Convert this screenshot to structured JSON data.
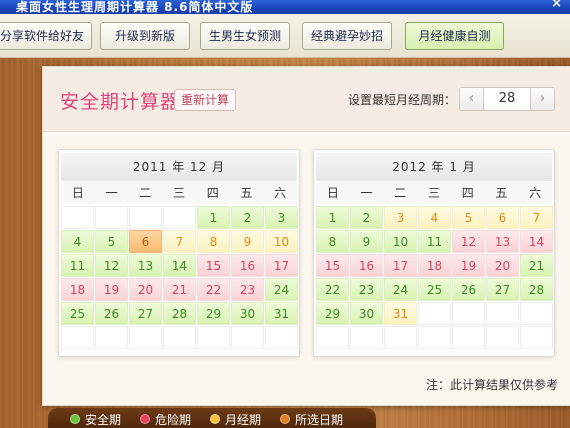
{
  "window": {
    "title": "桌面女性生理周期计算器 8.6简体中文版",
    "close_glyph": "×"
  },
  "toolbar": {
    "buttons": [
      {
        "label": "分享软件给好友",
        "active": false
      },
      {
        "label": "升级到新版",
        "active": false
      },
      {
        "label": "生男生女预测",
        "active": false
      },
      {
        "label": "经典避孕妙招",
        "active": false
      },
      {
        "label": "月经健康自测",
        "active": true
      }
    ]
  },
  "header": {
    "title": "安全期计算器",
    "recalc_label": "重新计算",
    "cycle_label": "设置最短月经周期：",
    "cycle_value": "28",
    "minus_glyph": "‹",
    "plus_glyph": "›"
  },
  "calendar": {
    "weekdays": [
      "日",
      "一",
      "二",
      "三",
      "四",
      "五",
      "六"
    ],
    "months": [
      {
        "title": "2011 年 12 月",
        "days": [
          {
            "d": "",
            "t": "empty"
          },
          {
            "d": "",
            "t": "empty"
          },
          {
            "d": "",
            "t": "empty"
          },
          {
            "d": "",
            "t": "empty"
          },
          {
            "d": "1",
            "t": "safe"
          },
          {
            "d": "2",
            "t": "safe"
          },
          {
            "d": "3",
            "t": "safe"
          },
          {
            "d": "4",
            "t": "safe"
          },
          {
            "d": "5",
            "t": "safe"
          },
          {
            "d": "6",
            "t": "selected"
          },
          {
            "d": "7",
            "t": "period"
          },
          {
            "d": "8",
            "t": "period"
          },
          {
            "d": "9",
            "t": "period"
          },
          {
            "d": "10",
            "t": "period"
          },
          {
            "d": "11",
            "t": "safe"
          },
          {
            "d": "12",
            "t": "safe"
          },
          {
            "d": "13",
            "t": "safe"
          },
          {
            "d": "14",
            "t": "safe"
          },
          {
            "d": "15",
            "t": "danger"
          },
          {
            "d": "16",
            "t": "danger"
          },
          {
            "d": "17",
            "t": "danger"
          },
          {
            "d": "18",
            "t": "danger"
          },
          {
            "d": "19",
            "t": "danger"
          },
          {
            "d": "20",
            "t": "danger"
          },
          {
            "d": "21",
            "t": "danger"
          },
          {
            "d": "22",
            "t": "danger"
          },
          {
            "d": "23",
            "t": "danger"
          },
          {
            "d": "24",
            "t": "safe"
          },
          {
            "d": "25",
            "t": "safe"
          },
          {
            "d": "26",
            "t": "safe"
          },
          {
            "d": "27",
            "t": "safe"
          },
          {
            "d": "28",
            "t": "safe"
          },
          {
            "d": "29",
            "t": "safe"
          },
          {
            "d": "30",
            "t": "safe"
          },
          {
            "d": "31",
            "t": "safe"
          },
          {
            "d": "",
            "t": "empty"
          },
          {
            "d": "",
            "t": "empty"
          },
          {
            "d": "",
            "t": "empty"
          },
          {
            "d": "",
            "t": "empty"
          },
          {
            "d": "",
            "t": "empty"
          },
          {
            "d": "",
            "t": "empty"
          },
          {
            "d": "",
            "t": "empty"
          }
        ]
      },
      {
        "title": "2012 年 1 月",
        "days": [
          {
            "d": "1",
            "t": "safe"
          },
          {
            "d": "2",
            "t": "safe"
          },
          {
            "d": "3",
            "t": "period"
          },
          {
            "d": "4",
            "t": "period"
          },
          {
            "d": "5",
            "t": "period"
          },
          {
            "d": "6",
            "t": "period"
          },
          {
            "d": "7",
            "t": "period"
          },
          {
            "d": "8",
            "t": "safe"
          },
          {
            "d": "9",
            "t": "safe"
          },
          {
            "d": "10",
            "t": "safe"
          },
          {
            "d": "11",
            "t": "safe"
          },
          {
            "d": "12",
            "t": "danger"
          },
          {
            "d": "13",
            "t": "danger"
          },
          {
            "d": "14",
            "t": "danger"
          },
          {
            "d": "15",
            "t": "danger"
          },
          {
            "d": "16",
            "t": "danger"
          },
          {
            "d": "17",
            "t": "danger"
          },
          {
            "d": "18",
            "t": "danger"
          },
          {
            "d": "19",
            "t": "danger"
          },
          {
            "d": "20",
            "t": "danger"
          },
          {
            "d": "21",
            "t": "safe"
          },
          {
            "d": "22",
            "t": "safe"
          },
          {
            "d": "23",
            "t": "safe"
          },
          {
            "d": "24",
            "t": "safe"
          },
          {
            "d": "25",
            "t": "safe"
          },
          {
            "d": "26",
            "t": "safe"
          },
          {
            "d": "27",
            "t": "safe"
          },
          {
            "d": "28",
            "t": "safe"
          },
          {
            "d": "29",
            "t": "safe"
          },
          {
            "d": "30",
            "t": "safe"
          },
          {
            "d": "31",
            "t": "period"
          },
          {
            "d": "",
            "t": "empty"
          },
          {
            "d": "",
            "t": "empty"
          },
          {
            "d": "",
            "t": "empty"
          },
          {
            "d": "",
            "t": "empty"
          },
          {
            "d": "",
            "t": "empty"
          },
          {
            "d": "",
            "t": "empty"
          },
          {
            "d": "",
            "t": "empty"
          },
          {
            "d": "",
            "t": "empty"
          },
          {
            "d": "",
            "t": "empty"
          },
          {
            "d": "",
            "t": "empty"
          },
          {
            "d": "",
            "t": "empty"
          }
        ]
      }
    ]
  },
  "note": "注：此计算结果仅供参考",
  "legend": {
    "items": [
      {
        "label": "安全期",
        "color": "#6cc43c",
        "icon": "safe-dot-icon"
      },
      {
        "label": "危险期",
        "color": "#e8425a",
        "icon": "danger-dot-icon"
      },
      {
        "label": "月经期",
        "color": "#f3c13a",
        "icon": "period-dot-icon"
      },
      {
        "label": "所选日期",
        "color": "#e0812a",
        "icon": "selected-dot-icon"
      }
    ]
  }
}
